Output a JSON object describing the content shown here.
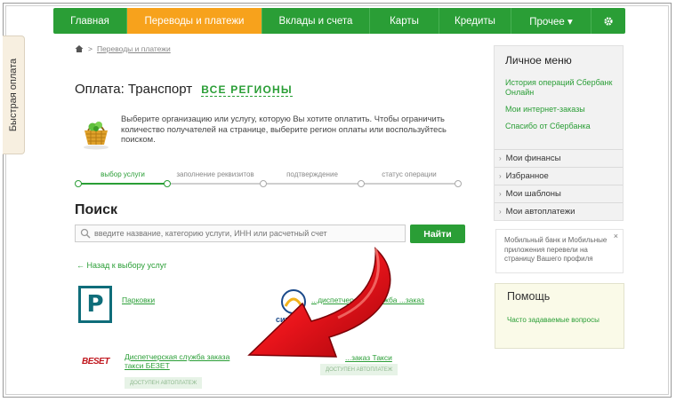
{
  "quick_pay": {
    "label": "Быстрая оплата"
  },
  "nav": {
    "items": [
      {
        "label": "Главная"
      },
      {
        "label": "Переводы и платежи"
      },
      {
        "label": "Вклады и счета"
      },
      {
        "label": "Карты"
      },
      {
        "label": "Кредиты"
      },
      {
        "label": "Прочее ▾"
      }
    ],
    "settings_icon": "gear-icon"
  },
  "breadcrumb": {
    "home_icon": "home-icon",
    "separator": ">",
    "item": "Переводы и платежи"
  },
  "page": {
    "title": "Оплата: Транспорт",
    "regions_link": "ВСЕ РЕГИОНЫ",
    "info_text": "Выберите организацию или услугу, которую Вы хотите оплатить. Чтобы ограничить количество получателей на странице, выберите регион оплаты или воспользуйтесь поиском."
  },
  "steps": [
    {
      "label": "выбор услуги"
    },
    {
      "label": "заполнение реквизитов"
    },
    {
      "label": "подтверждение"
    },
    {
      "label": "статус операции"
    }
  ],
  "search": {
    "title": "Поиск",
    "placeholder": "введите название, категорию услуги, ИНН или расчетный счет",
    "button": "Найти"
  },
  "back_link": "← Назад к выбору услуг",
  "organizations": [
    {
      "name": "Парковки",
      "logo": "parking-logo",
      "logo_letter": "P"
    },
    {
      "name": "...диспетчерская служба ...заказ",
      "logo": "city-logo",
      "logo_text": "сит"
    },
    {
      "name": "Диспетчерская служба заказа такси БЕЗЕТ",
      "name_line2": "БЕЗЕТ",
      "logo": "beset-logo",
      "logo_text": "BESET",
      "badge": "ДОСТУПЕН АВТОПЛАТЕЖ"
    },
    {
      "name": "...заказ Такси",
      "badge": "ДОСТУПЕН АВТОПЛАТЕЖ"
    }
  ],
  "sidebar": {
    "personal_menu": {
      "title": "Личное меню",
      "links": [
        {
          "label": "История операций Сбербанк Онлайн"
        },
        {
          "label": "Мои интернет-заказы"
        },
        {
          "label": "Спасибо от Сбербанка"
        }
      ],
      "items": [
        {
          "label": "Мои финансы"
        },
        {
          "label": "Избранное"
        },
        {
          "label": "Мои шаблоны"
        },
        {
          "label": "Мои автоплатежи"
        }
      ]
    },
    "notice": {
      "text": "Мобильный банк и Мобильные приложения перевели на страницу Вашего профиля",
      "close": "×"
    },
    "help": {
      "title": "Помощь",
      "link": "Часто задаваемые вопросы"
    }
  },
  "colors": {
    "brand_green": "#2a9e36",
    "active_orange": "#f7a21c",
    "arrow_red": "#e8141b"
  }
}
